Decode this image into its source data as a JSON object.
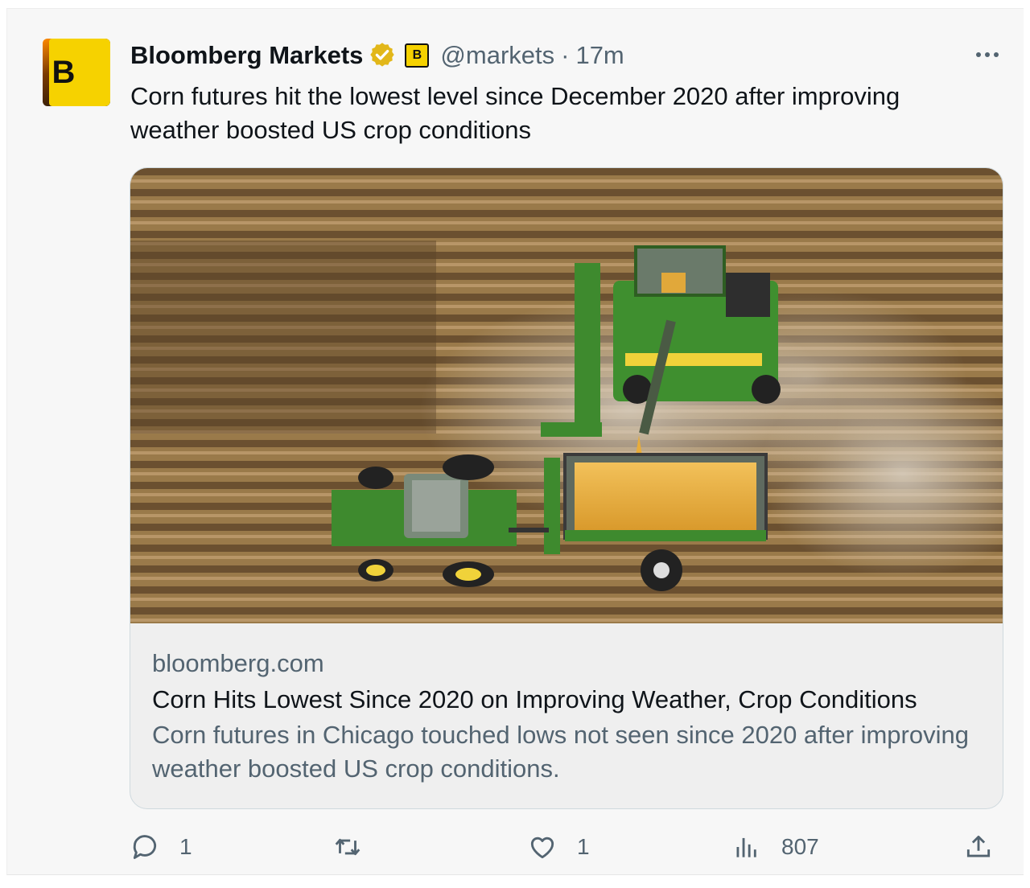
{
  "tweet": {
    "author_name": "Bloomberg Markets",
    "handle": "@markets",
    "separator": "·",
    "time": "17m",
    "avatar_letter": "B",
    "mini_logo_letter": "B",
    "text": "Corn futures hit the lowest level since December 2020 after improving weather boosted US crop conditions"
  },
  "card": {
    "domain": "bloomberg.com",
    "title": "Corn Hits Lowest Since 2020 on Improving Weather, Crop Conditions",
    "description": "Corn futures in Chicago touched lows not seen since 2020 after improving weather boosted US crop conditions."
  },
  "actions": {
    "replies": "1",
    "retweets": "",
    "likes": "1",
    "views": "807"
  },
  "colors": {
    "brand_yellow": "#f6d200",
    "verified_gold": "#e2b719",
    "secondary_text": "#536471",
    "primary_text": "#0f1419"
  },
  "icons": [
    "verified-badge-icon",
    "more-icon",
    "reply-icon",
    "retweet-icon",
    "like-icon",
    "views-icon",
    "share-icon"
  ]
}
